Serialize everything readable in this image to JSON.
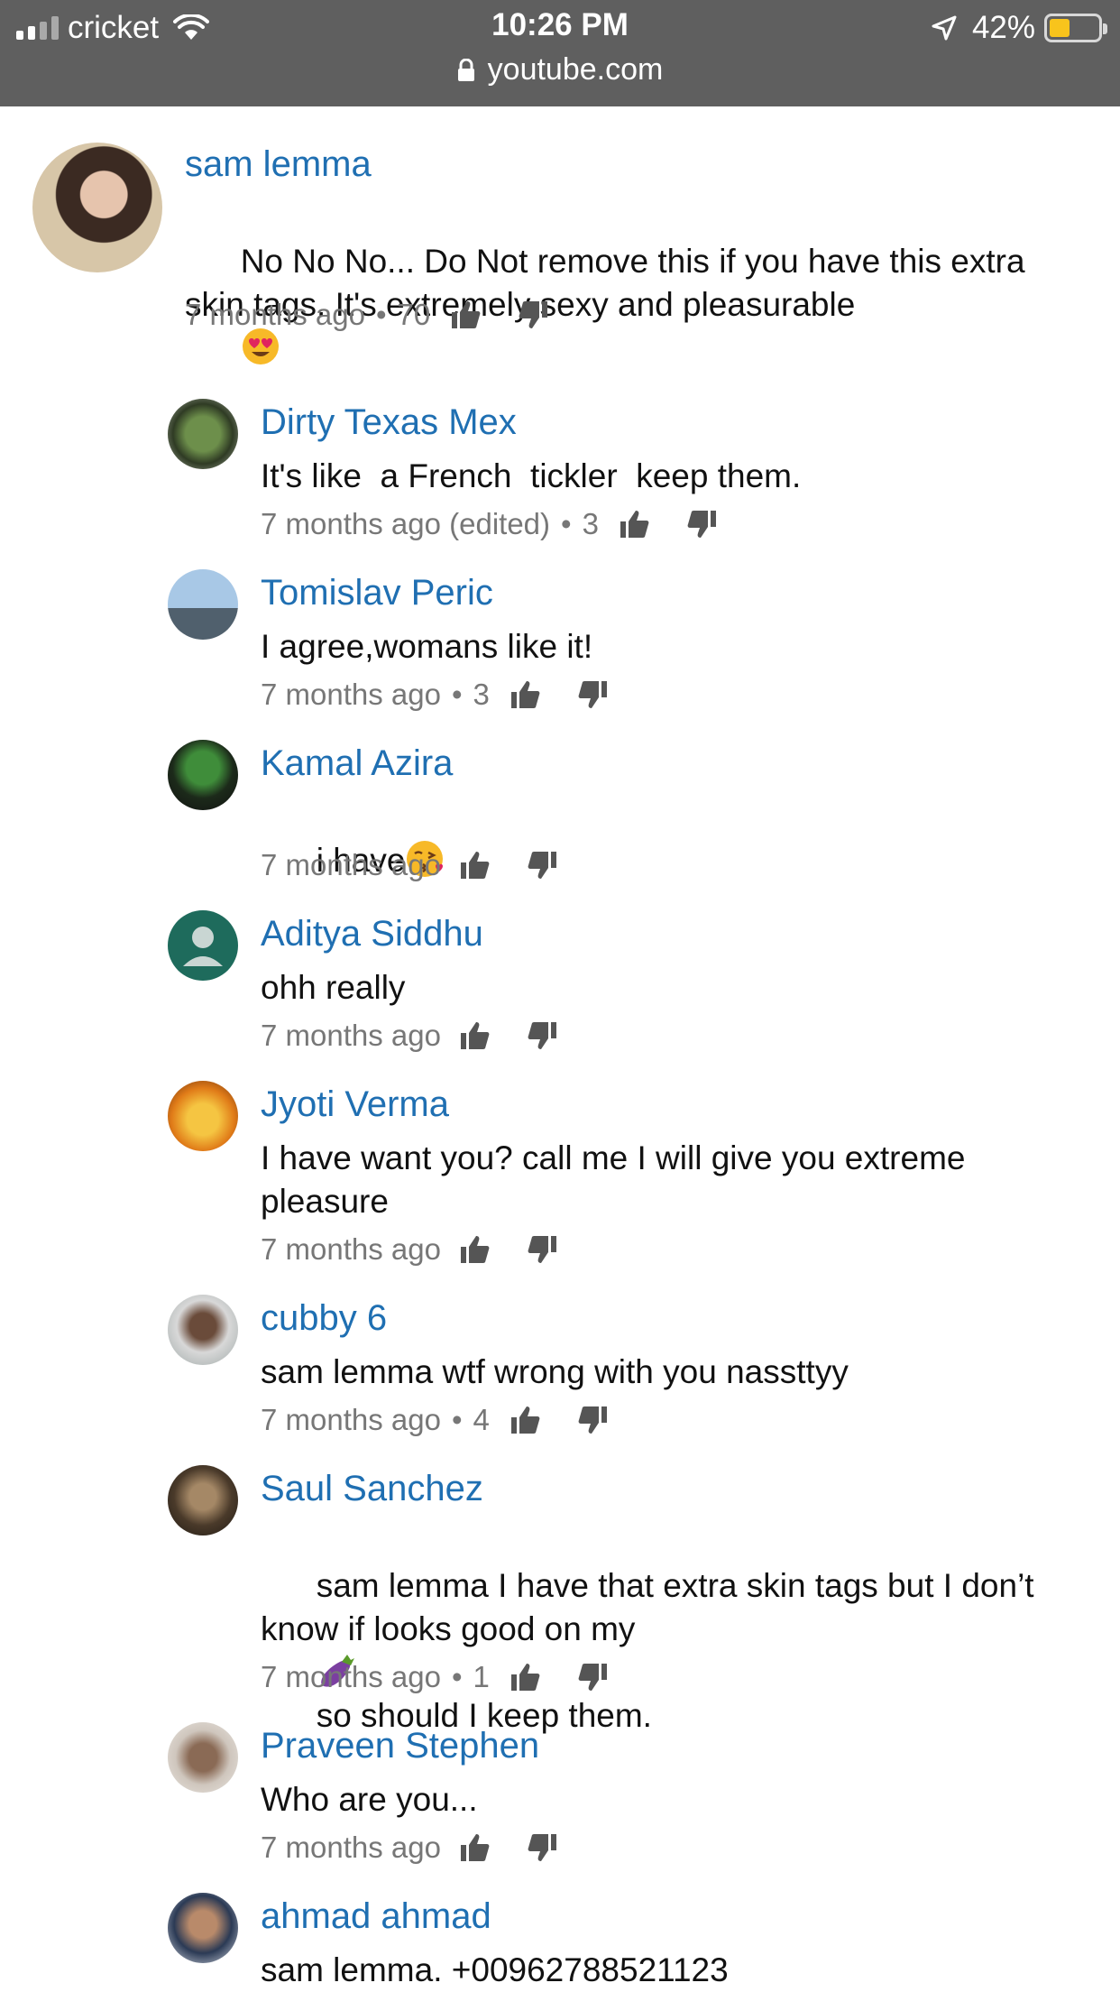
{
  "status_bar": {
    "carrier": "cricket",
    "time": "10:26 PM",
    "battery": "42%",
    "battery_level": 0.42,
    "url": "youtube.com"
  },
  "colors": {
    "status_bg": "#5f5f5f",
    "author_link": "#1f6fb2",
    "meta_text": "#777777"
  },
  "comments": [
    {
      "author": "sam lemma",
      "text": "No No No... Do Not remove this if you have this extra skin tags. It's extremely sexy and pleasurable",
      "emoji": "heart-eyes-emoji",
      "time": "7 months ago",
      "likes": "70",
      "avatar": "avatar-photo"
    },
    {
      "author": "Dirty Texas Mex",
      "text": "It's like  a French  tickler  keep them.",
      "time": "7 months ago (edited)",
      "likes": "3",
      "avatar": "avatar-photo"
    },
    {
      "author": "Tomislav Peric",
      "text": "I agree,womans like it!",
      "time": "7 months ago",
      "likes": "3",
      "avatar": "avatar-photo"
    },
    {
      "author": "Kamal Azira",
      "text": "i have",
      "emoji": "kissing-emoji",
      "time": "7 months ago",
      "likes": "",
      "avatar": "avatar-photo"
    },
    {
      "author": "Aditya Siddhu",
      "text": "ohh really",
      "time": "7 months ago",
      "likes": "",
      "avatar": "default-avatar"
    },
    {
      "author": "Jyoti Verma",
      "text": "I have want you? call me I will give you extreme pleasure",
      "time": "7 months ago",
      "likes": "",
      "avatar": "avatar-photo"
    },
    {
      "author": "cubby 6",
      "text": "sam lemma wtf wrong with you nassttyy",
      "time": "7 months ago",
      "likes": "4",
      "avatar": "avatar-photo"
    },
    {
      "author": "Saul Sanchez",
      "text_before": "sam lemma I have that extra skin tags but I don’t know if looks good on my",
      "emoji": "eggplant-emoji",
      "text_after": "so should I keep them.",
      "time": "7 months ago",
      "likes": "1",
      "avatar": "avatar-photo"
    },
    {
      "author": "Praveen Stephen",
      "text": "Who are you...",
      "time": "7 months ago",
      "likes": "",
      "avatar": "avatar-photo"
    },
    {
      "author": "ahmad ahmad",
      "text": "sam lemma. +00962788521123",
      "avatar": "avatar-photo"
    }
  ]
}
